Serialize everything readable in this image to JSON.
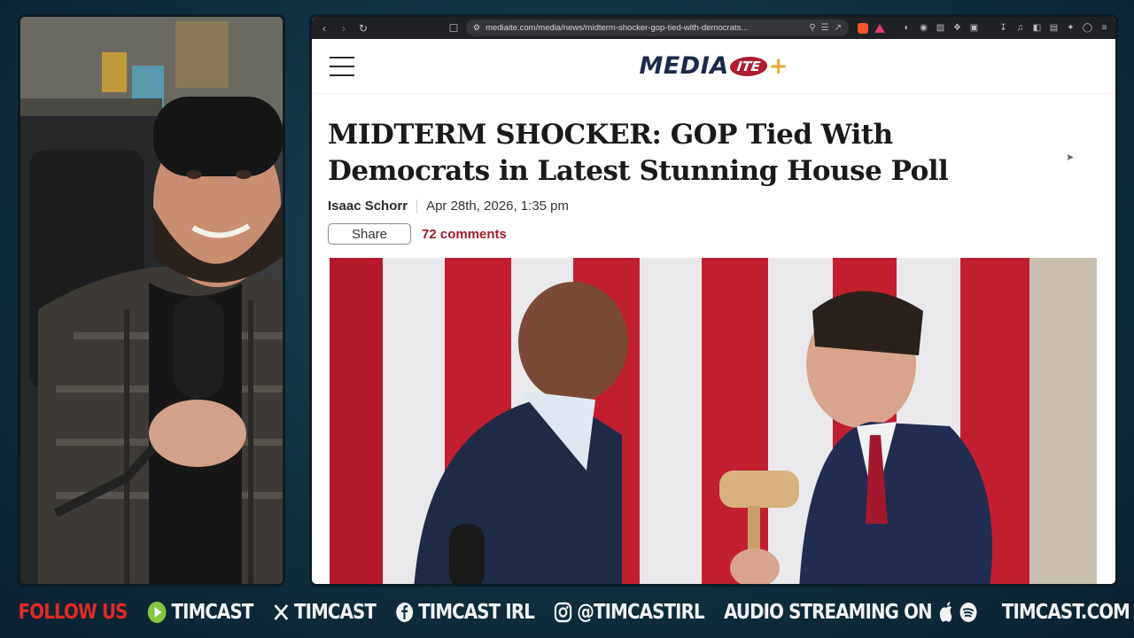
{
  "browser": {
    "url": "mediaite.com/media/news/midterm-shocker-gop-tied-with-democrats..."
  },
  "site": {
    "logo_main": "MEDIA",
    "logo_badge": "ITE",
    "logo_plus": "+"
  },
  "article": {
    "headline": "MIDTERM SHOCKER: GOP Tied With Democrats in Latest Stunning House Poll",
    "author": "Isaac Schorr",
    "date": "Apr 28th, 2026, 1:35 pm",
    "share_label": "Share",
    "comments_label": "72 comments"
  },
  "footer": {
    "follow": "FOLLOW US",
    "rumble": "TIMCAST",
    "x": "TIMCAST",
    "facebook": "TIMCAST IRL",
    "instagram": "@TIMCASTIRL",
    "audio": "AUDIO STREAMING ON",
    "website": "TIMCAST.COM"
  },
  "colors": {
    "follow_red": "#e02a26",
    "comments_red": "#a31b2b",
    "logo_navy": "#1b2a4a",
    "logo_gold": "#e7a93b"
  }
}
